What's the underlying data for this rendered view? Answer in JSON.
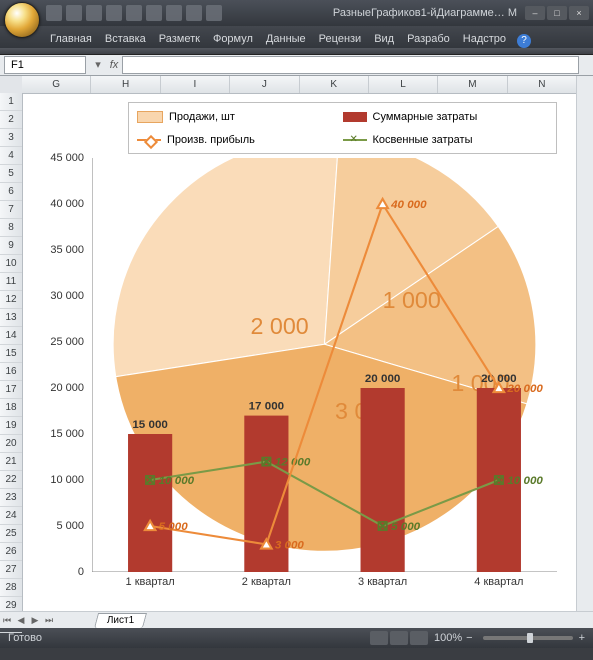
{
  "window": {
    "title": "РазныеГрафиков1-йДиаграмме… M",
    "titlebar_icons": [
      "save",
      "undo",
      "redo",
      "print",
      "quick-print",
      "preview",
      "sort",
      "filter",
      "more"
    ]
  },
  "ribbon": {
    "tabs": [
      "Главная",
      "Вставка",
      "Разметк",
      "Формул",
      "Данные",
      "Рецензи",
      "Вид",
      "Разрабо",
      "Надстро"
    ]
  },
  "formula_bar": {
    "name_box": "F1",
    "fx_label": "fx",
    "value": ""
  },
  "columns": [
    "G",
    "H",
    "I",
    "J",
    "K",
    "L",
    "M",
    "N"
  ],
  "rows_visible": 30,
  "sheet_tab": "Лист1",
  "status": {
    "left": "Готово",
    "zoom": "100%"
  },
  "legend": {
    "s1": "Продажи, шт",
    "s2": "Суммарные затраты",
    "s3": "Произв. прибыль",
    "s4": "Косвенные затраты"
  },
  "colors": {
    "pie_fill": "#f9d6ae",
    "pie_dark": "#f0b679",
    "bar": "#b23a2e",
    "orange": "#ed8b3a",
    "green": "#7a9a47"
  },
  "chart_data": {
    "type": "combo",
    "categories": [
      "1 квартал",
      "2 квартал",
      "3 квартал",
      "4 квартал"
    ],
    "ylim": [
      0,
      45000
    ],
    "yticks": [
      0,
      5000,
      10000,
      15000,
      20000,
      25000,
      30000,
      35000,
      40000,
      45000
    ],
    "ytick_labels": [
      "0",
      "5 000",
      "10 000",
      "15 000",
      "20 000",
      "25 000",
      "30 000",
      "35 000",
      "40 000",
      "45 000"
    ],
    "series": [
      {
        "name": "Продажи, шт",
        "type": "pie",
        "values": [
          2000,
          1000,
          1000,
          3000
        ],
        "labels": [
          "2 000",
          "1 000",
          "1 000",
          "3 000"
        ]
      },
      {
        "name": "Суммарные затраты",
        "type": "bar",
        "values": [
          15000,
          17000,
          20000,
          20000
        ],
        "labels": [
          "15 000",
          "17 000",
          "20 000",
          "20 000"
        ]
      },
      {
        "name": "Произв. прибыль",
        "type": "line",
        "values": [
          5000,
          3000,
          40000,
          20000
        ],
        "labels": [
          "5 000",
          "3 000",
          "40 000",
          "20 000"
        ],
        "color": "#ed8b3a",
        "marker": "triangle"
      },
      {
        "name": "Косвенные затраты",
        "type": "line",
        "values": [
          10000,
          12000,
          5000,
          10000
        ],
        "labels": [
          "10 000",
          "12 000",
          "5 000",
          "10 000"
        ],
        "color": "#7a9a47",
        "marker": "x"
      }
    ]
  }
}
